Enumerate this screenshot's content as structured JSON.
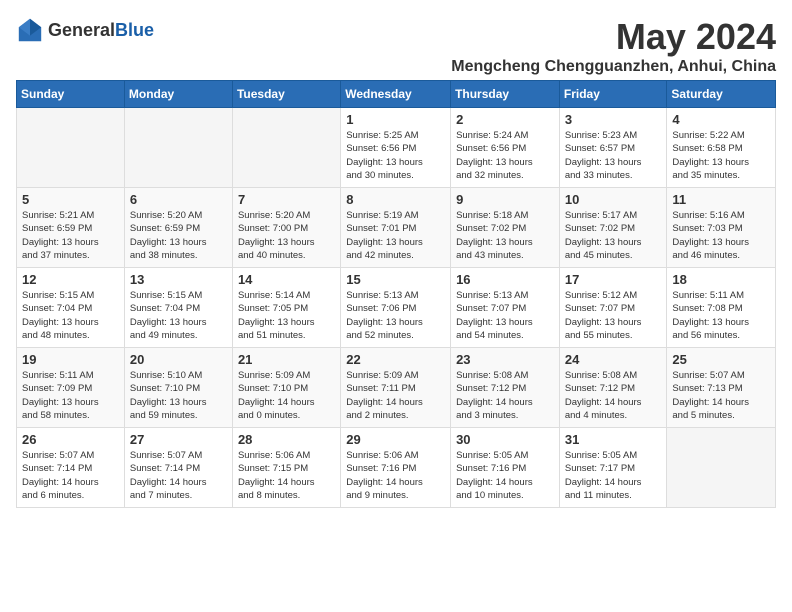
{
  "header": {
    "logo_general": "General",
    "logo_blue": "Blue",
    "title": "May 2024",
    "location": "Mengcheng Chengguanzhen, Anhui, China"
  },
  "weekdays": [
    "Sunday",
    "Monday",
    "Tuesday",
    "Wednesday",
    "Thursday",
    "Friday",
    "Saturday"
  ],
  "weeks": [
    [
      {
        "day": "",
        "info": ""
      },
      {
        "day": "",
        "info": ""
      },
      {
        "day": "",
        "info": ""
      },
      {
        "day": "1",
        "info": "Sunrise: 5:25 AM\nSunset: 6:56 PM\nDaylight: 13 hours\nand 30 minutes."
      },
      {
        "day": "2",
        "info": "Sunrise: 5:24 AM\nSunset: 6:56 PM\nDaylight: 13 hours\nand 32 minutes."
      },
      {
        "day": "3",
        "info": "Sunrise: 5:23 AM\nSunset: 6:57 PM\nDaylight: 13 hours\nand 33 minutes."
      },
      {
        "day": "4",
        "info": "Sunrise: 5:22 AM\nSunset: 6:58 PM\nDaylight: 13 hours\nand 35 minutes."
      }
    ],
    [
      {
        "day": "5",
        "info": "Sunrise: 5:21 AM\nSunset: 6:59 PM\nDaylight: 13 hours\nand 37 minutes."
      },
      {
        "day": "6",
        "info": "Sunrise: 5:20 AM\nSunset: 6:59 PM\nDaylight: 13 hours\nand 38 minutes."
      },
      {
        "day": "7",
        "info": "Sunrise: 5:20 AM\nSunset: 7:00 PM\nDaylight: 13 hours\nand 40 minutes."
      },
      {
        "day": "8",
        "info": "Sunrise: 5:19 AM\nSunset: 7:01 PM\nDaylight: 13 hours\nand 42 minutes."
      },
      {
        "day": "9",
        "info": "Sunrise: 5:18 AM\nSunset: 7:02 PM\nDaylight: 13 hours\nand 43 minutes."
      },
      {
        "day": "10",
        "info": "Sunrise: 5:17 AM\nSunset: 7:02 PM\nDaylight: 13 hours\nand 45 minutes."
      },
      {
        "day": "11",
        "info": "Sunrise: 5:16 AM\nSunset: 7:03 PM\nDaylight: 13 hours\nand 46 minutes."
      }
    ],
    [
      {
        "day": "12",
        "info": "Sunrise: 5:15 AM\nSunset: 7:04 PM\nDaylight: 13 hours\nand 48 minutes."
      },
      {
        "day": "13",
        "info": "Sunrise: 5:15 AM\nSunset: 7:04 PM\nDaylight: 13 hours\nand 49 minutes."
      },
      {
        "day": "14",
        "info": "Sunrise: 5:14 AM\nSunset: 7:05 PM\nDaylight: 13 hours\nand 51 minutes."
      },
      {
        "day": "15",
        "info": "Sunrise: 5:13 AM\nSunset: 7:06 PM\nDaylight: 13 hours\nand 52 minutes."
      },
      {
        "day": "16",
        "info": "Sunrise: 5:13 AM\nSunset: 7:07 PM\nDaylight: 13 hours\nand 54 minutes."
      },
      {
        "day": "17",
        "info": "Sunrise: 5:12 AM\nSunset: 7:07 PM\nDaylight: 13 hours\nand 55 minutes."
      },
      {
        "day": "18",
        "info": "Sunrise: 5:11 AM\nSunset: 7:08 PM\nDaylight: 13 hours\nand 56 minutes."
      }
    ],
    [
      {
        "day": "19",
        "info": "Sunrise: 5:11 AM\nSunset: 7:09 PM\nDaylight: 13 hours\nand 58 minutes."
      },
      {
        "day": "20",
        "info": "Sunrise: 5:10 AM\nSunset: 7:10 PM\nDaylight: 13 hours\nand 59 minutes."
      },
      {
        "day": "21",
        "info": "Sunrise: 5:09 AM\nSunset: 7:10 PM\nDaylight: 14 hours\nand 0 minutes."
      },
      {
        "day": "22",
        "info": "Sunrise: 5:09 AM\nSunset: 7:11 PM\nDaylight: 14 hours\nand 2 minutes."
      },
      {
        "day": "23",
        "info": "Sunrise: 5:08 AM\nSunset: 7:12 PM\nDaylight: 14 hours\nand 3 minutes."
      },
      {
        "day": "24",
        "info": "Sunrise: 5:08 AM\nSunset: 7:12 PM\nDaylight: 14 hours\nand 4 minutes."
      },
      {
        "day": "25",
        "info": "Sunrise: 5:07 AM\nSunset: 7:13 PM\nDaylight: 14 hours\nand 5 minutes."
      }
    ],
    [
      {
        "day": "26",
        "info": "Sunrise: 5:07 AM\nSunset: 7:14 PM\nDaylight: 14 hours\nand 6 minutes."
      },
      {
        "day": "27",
        "info": "Sunrise: 5:07 AM\nSunset: 7:14 PM\nDaylight: 14 hours\nand 7 minutes."
      },
      {
        "day": "28",
        "info": "Sunrise: 5:06 AM\nSunset: 7:15 PM\nDaylight: 14 hours\nand 8 minutes."
      },
      {
        "day": "29",
        "info": "Sunrise: 5:06 AM\nSunset: 7:16 PM\nDaylight: 14 hours\nand 9 minutes."
      },
      {
        "day": "30",
        "info": "Sunrise: 5:05 AM\nSunset: 7:16 PM\nDaylight: 14 hours\nand 10 minutes."
      },
      {
        "day": "31",
        "info": "Sunrise: 5:05 AM\nSunset: 7:17 PM\nDaylight: 14 hours\nand 11 minutes."
      },
      {
        "day": "",
        "info": ""
      }
    ]
  ]
}
